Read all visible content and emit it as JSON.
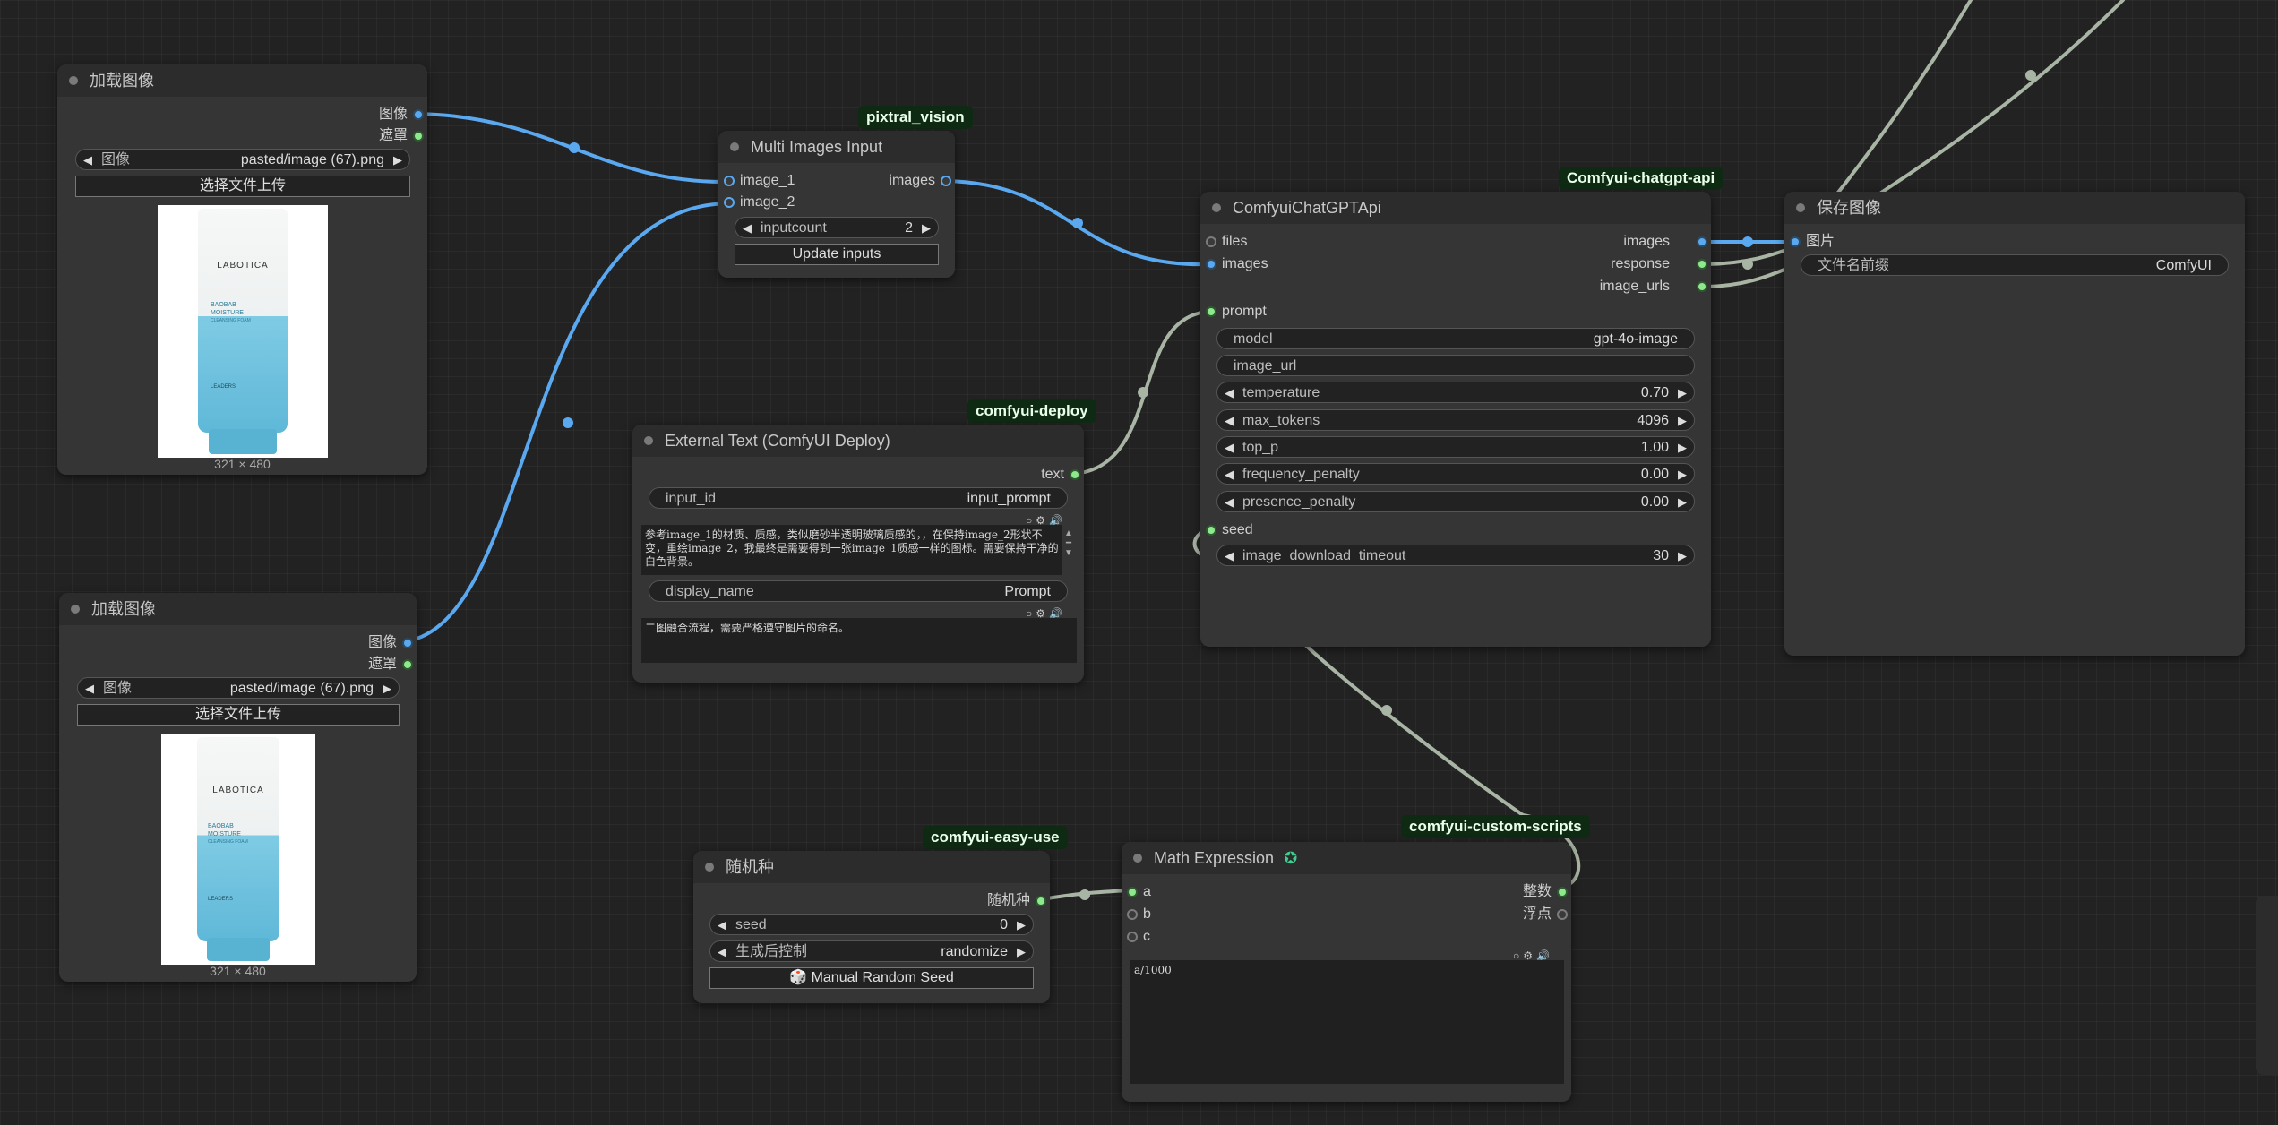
{
  "nodes": {
    "load1": {
      "title": "加载图像",
      "out_image": "图像",
      "out_mask": "遮罩",
      "widget_label": "图像",
      "widget_value": "pasted/image (67).png",
      "upload_button": "选择文件上传",
      "caption": "321 × 480",
      "product": {
        "brand": "LABOTICA",
        "line1": "BAOBAB",
        "line2": "MOISTURE",
        "line3": "CLEANSING FOAM",
        "maker": "LEADERS"
      }
    },
    "load2": {
      "title": "加载图像",
      "out_image": "图像",
      "out_mask": "遮罩",
      "widget_label": "图像",
      "widget_value": "pasted/image (67).png",
      "upload_button": "选择文件上传",
      "caption": "321 × 480",
      "product": {
        "brand": "LABOTICA",
        "line1": "BAOBAB",
        "line2": "MOISTURE",
        "line3": "CLEANSING FOAM",
        "maker": "LEADERS"
      }
    },
    "multi": {
      "badge": "pixtral_vision",
      "title": "Multi Images Input",
      "in1": "image_1",
      "in2": "image_2",
      "out": "images",
      "count_label": "inputcount",
      "count_value": "2",
      "update_button": "Update inputs"
    },
    "external": {
      "badge": "comfyui-deploy",
      "title": "External Text (ComfyUI Deploy)",
      "out": "text",
      "input_id_label": "input_id",
      "input_id_value": "input_prompt",
      "prompt_text": "参考image_1的材质、质感，类似磨砂半透明玻璃质感的，，在保持image_2形状不变，重绘image_2，我最终是需要得到一张image_1质感一样的图标。需要保持干净的白色背景。",
      "display_name_label": "display_name",
      "display_name_value": "Prompt",
      "desc_text": "二图融合流程，需要严格遵守图片的命名。"
    },
    "chatgpt": {
      "badge": "Comfyui-chatgpt-api",
      "title": "ComfyuiChatGPTApi",
      "in_files": "files",
      "in_images": "images",
      "in_prompt": "prompt",
      "in_seed": "seed",
      "out_images": "images",
      "out_response": "response",
      "out_urls": "image_urls",
      "model_label": "model",
      "model_value": "gpt-4o-image",
      "image_url_label": "image_url",
      "temperature_label": "temperature",
      "temperature_value": "0.70",
      "max_tokens_label": "max_tokens",
      "max_tokens_value": "4096",
      "top_p_label": "top_p",
      "top_p_value": "1.00",
      "freq_label": "frequency_penalty",
      "freq_value": "0.00",
      "presence_label": "presence_penalty",
      "presence_value": "0.00",
      "timeout_label": "image_download_timeout",
      "timeout_value": "30"
    },
    "save": {
      "title": "保存图像",
      "in_image": "图片",
      "prefix_label": "文件名前缀",
      "prefix_value": "ComfyUI"
    },
    "seed": {
      "badge": "comfyui-easy-use",
      "title": "随机种",
      "out": "随机种",
      "seed_label": "seed",
      "seed_value": "0",
      "control_label": "生成后控制",
      "control_value": "randomize",
      "button": "Manual Random Seed"
    },
    "math": {
      "badge": "comfyui-custom-scripts",
      "title": "Math Expression",
      "in_a": "a",
      "in_b": "b",
      "in_c": "c",
      "out_int": "整数",
      "out_float": "浮点",
      "expression": "a/1000"
    }
  },
  "colors": {
    "image_link": "#5aa8f0",
    "other_link": "#a9b5a4",
    "badge_bg": "#0f2a12"
  }
}
